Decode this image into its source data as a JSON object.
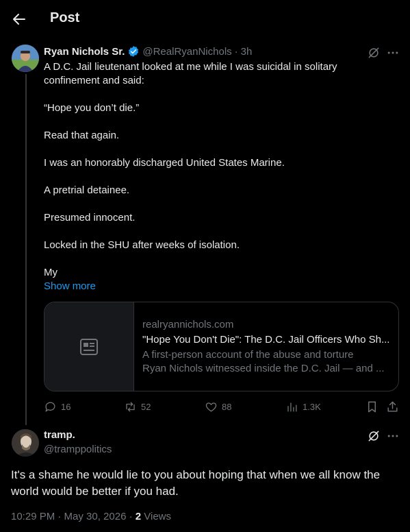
{
  "header": {
    "title": "Post"
  },
  "post": {
    "author_name": "Ryan Nichols Sr.",
    "handle": "@RealRyanNichols",
    "separator": "·",
    "time": "3h",
    "paragraphs": [
      "A D.C. Jail lieutenant looked at me while I was suicidal in solitary confinement and said:",
      "“Hope you don’t die.”",
      "Read that again.",
      "I was an honorably discharged United States Marine.",
      "A pretrial detainee.",
      "Presumed innocent.",
      "Locked in the SHU after weeks of isolation.",
      "My"
    ],
    "show_more": "Show more",
    "card": {
      "domain": "realryannichols.com",
      "title": "\"Hope You Don't Die\": The D.C. Jail Officers Who Sh...",
      "desc_line1": "A first-person account of the abuse and torture",
      "desc_line2": "Ryan Nichols witnessed inside the D.C. Jail — and ..."
    },
    "actions": {
      "replies": "16",
      "reposts": "52",
      "likes": "88",
      "views": "1.3K"
    }
  },
  "reply": {
    "author_name": "tramp.",
    "handle": "@tramppolitics",
    "text": "It's a shame he would lie to you about hoping that when we all know the world would be better if you had.",
    "timestamp": "10:29 PM · May 30, 2026 · ",
    "views_count": "2",
    "views_label": " Views"
  },
  "colors": {
    "accent": "#1d9bf0",
    "verified": "#1d9bf0",
    "muted": "#71767b",
    "background": "#000000"
  }
}
